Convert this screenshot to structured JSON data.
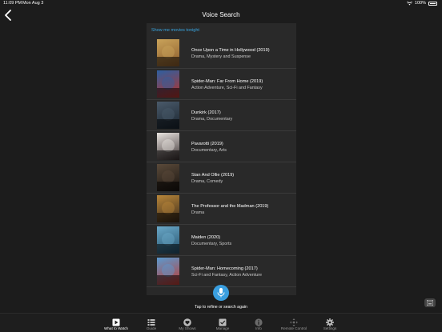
{
  "status_bar": {
    "time": "11:09 PM",
    "date": "Mon Aug 3",
    "battery": "100%"
  },
  "header": {
    "title": "Voice Search"
  },
  "query": "Show me movies tonight",
  "results": [
    {
      "title": "Once Upon a Time in Hollywood (2019)",
      "genres": "Drama, Mystery and Suspense",
      "poster_colors": [
        "#c9a35a",
        "#8a5a2a"
      ]
    },
    {
      "title": "Spider-Man: Far From Home (2019)",
      "genres": "Action Adventure, Sci-Fi and Fantasy",
      "poster_colors": [
        "#2e5fa0",
        "#b8322a"
      ]
    },
    {
      "title": "Dunkirk (2017)",
      "genres": "Drama, Documentary",
      "poster_colors": [
        "#4a5a6a",
        "#1a2530"
      ]
    },
    {
      "title": "Pavarotti (2019)",
      "genres": "Documentary, Arts",
      "poster_colors": [
        "#e9e4e0",
        "#3a3030"
      ]
    },
    {
      "title": "Stan And Ollie (2019)",
      "genres": "Drama, Comedy",
      "poster_colors": [
        "#5a4a3a",
        "#1a1410"
      ]
    },
    {
      "title": "The Professor and the Madman (2019)",
      "genres": "Drama",
      "poster_colors": [
        "#b8863a",
        "#3a2a1a"
      ]
    },
    {
      "title": "Maiden (2020)",
      "genres": "Documentary, Sports",
      "poster_colors": [
        "#6aa8c8",
        "#24506a"
      ]
    },
    {
      "title": "Spider-Man: Homecoming (2017)",
      "genres": "Sci-Fi and Fantasy, Action Adventure",
      "poster_colors": [
        "#5a9ad0",
        "#c03a30"
      ]
    }
  ],
  "refine_hint": "Tap to refine or search again",
  "tabs": [
    {
      "label": "What to Watch",
      "icon": "play-icon"
    },
    {
      "label": "Guide",
      "icon": "list-icon"
    },
    {
      "label": "My Shows",
      "icon": "heart-icon"
    },
    {
      "label": "Manage",
      "icon": "check-box-icon"
    },
    {
      "label": "Info",
      "icon": "info-icon"
    },
    {
      "label": "Remote Control",
      "icon": "dpad-icon"
    },
    {
      "label": "Settings",
      "icon": "gear-icon"
    }
  ],
  "colors": {
    "accent": "#38a5e0",
    "mic": "#3a9fe0",
    "background": "#1c1c1c",
    "panel": "#292929"
  }
}
